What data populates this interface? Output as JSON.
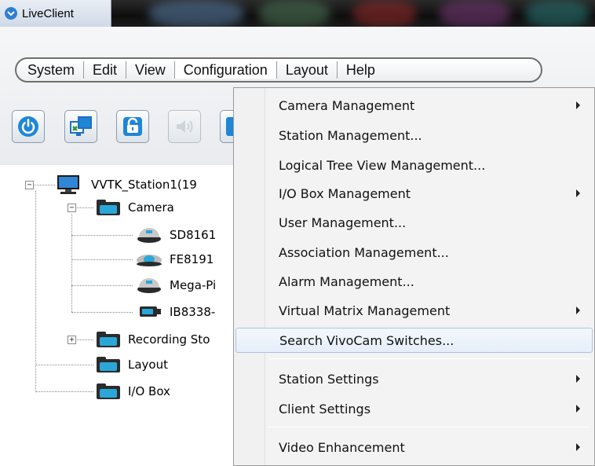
{
  "window": {
    "title": "LiveClient"
  },
  "menubar": {
    "items": [
      {
        "label": "System"
      },
      {
        "label": "Edit"
      },
      {
        "label": "View"
      },
      {
        "label": "Configuration",
        "active": true
      },
      {
        "label": "Layout"
      },
      {
        "label": "Help"
      }
    ]
  },
  "toolbar": {
    "buttons": [
      {
        "icon": "power-icon"
      },
      {
        "icon": "monitor-switch-icon"
      },
      {
        "icon": "unlock-icon"
      },
      {
        "icon": "speaker-icon",
        "disabled": true
      },
      {
        "icon": "partial-button-icon"
      }
    ]
  },
  "tree": {
    "station": {
      "label": "VVTK_Station1(19"
    },
    "camera_folder": {
      "label": "Camera"
    },
    "cameras": [
      {
        "label": "SD8161",
        "icon": "speed-dome-camera-icon"
      },
      {
        "label": "FE8191",
        "icon": "fisheye-camera-icon"
      },
      {
        "label": "Mega-Pi",
        "icon": "dome-camera-icon"
      },
      {
        "label": "IB8338-",
        "icon": "bullet-camera-icon"
      }
    ],
    "recording": {
      "label": "Recording Sto"
    },
    "layout": {
      "label": "Layout"
    },
    "iobox": {
      "label": "I/O Box"
    }
  },
  "configuration_menu": {
    "items": [
      {
        "label": "Camera Management",
        "submenu": true
      },
      {
        "label": "Station Management...",
        "submenu": false
      },
      {
        "label": "Logical Tree View Management...",
        "submenu": false
      },
      {
        "label": "I/O Box Management",
        "submenu": true
      },
      {
        "label": "User Management...",
        "submenu": false
      },
      {
        "label": "Association Management...",
        "submenu": false
      },
      {
        "label": "Alarm Management...",
        "submenu": false
      },
      {
        "label": "Virtual Matrix Management",
        "submenu": true
      },
      {
        "label": "Search VivoCam Switches...",
        "submenu": false,
        "highlighted": true
      },
      {
        "label": "Station Settings",
        "submenu": true
      },
      {
        "label": "Client Settings",
        "submenu": true
      },
      {
        "label": "Video Enhancement",
        "submenu": true
      }
    ]
  },
  "colors": {
    "accent": "#2f7fd1",
    "folder_blue": "#2aa7d8",
    "highlight_border": "#a9c2e3"
  }
}
